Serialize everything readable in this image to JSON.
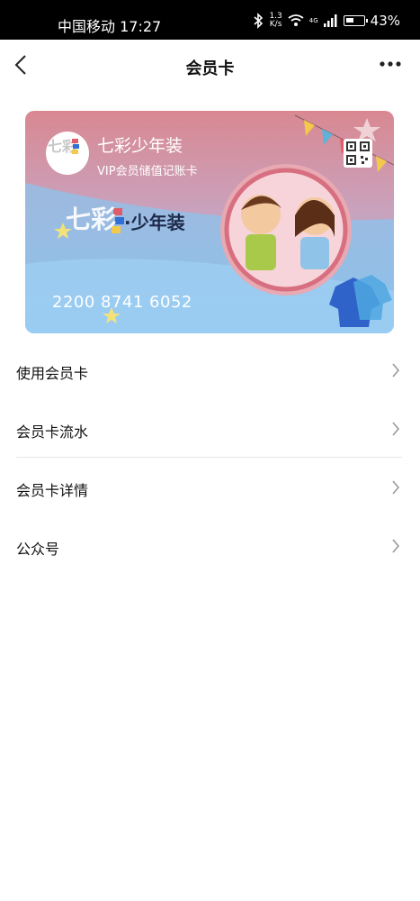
{
  "status_bar": {
    "carrier_time": "中国移动 17:27",
    "net_speed_value": "1.3",
    "net_speed_unit": "K/s",
    "network": "4G",
    "battery": "43%"
  },
  "nav": {
    "title": "会员卡",
    "back_icon": "back-chevron-icon",
    "more_icon": "more-dots-icon"
  },
  "card": {
    "shop_name": "七彩少年装",
    "card_type": "VIP会员储值记账卡",
    "card_number": "2200 8741 6052",
    "brand_text": "·少年装",
    "logo_text": "七彩",
    "colors": {
      "top": "#d98a94",
      "bottom": "#8cc6ee",
      "accent": "#e05c6a"
    }
  },
  "menu": {
    "items": [
      {
        "label": "使用会员卡"
      },
      {
        "label": "会员卡流水"
      },
      {
        "label": "会员卡详情"
      },
      {
        "label": "公众号"
      }
    ]
  }
}
